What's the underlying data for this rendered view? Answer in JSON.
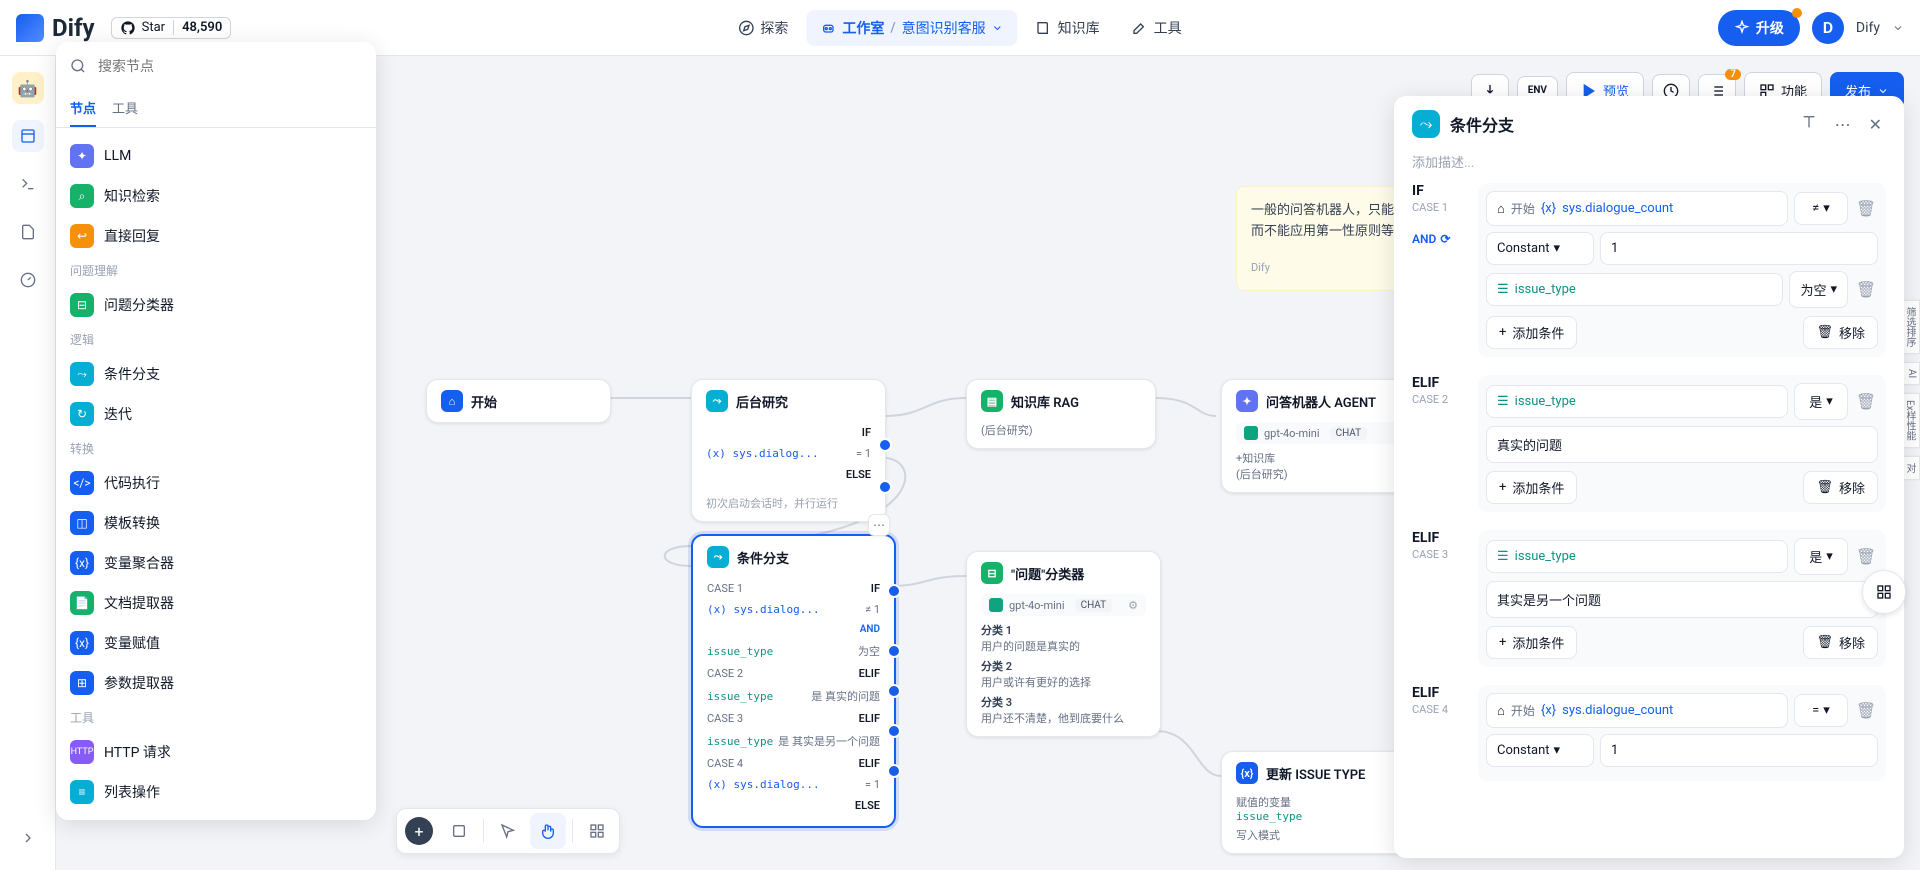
{
  "header": {
    "logo": "Dify",
    "star_label": "Star",
    "star_count": "48,590",
    "nav": {
      "explore": "探索",
      "studio": "工作室",
      "crumb": "意图识别客服",
      "knowledge": "知识库",
      "tools": "工具"
    },
    "upgrade": "升级",
    "avatar_letter": "D",
    "user": "Dify"
  },
  "node_panel": {
    "search_placeholder": "搜索节点",
    "tabs": {
      "nodes": "节点",
      "tools": "工具"
    },
    "items": [
      {
        "label": "LLM",
        "color": "#6172f3"
      },
      {
        "label": "知识检索",
        "color": "#17b26a"
      },
      {
        "label": "直接回复",
        "color": "#f79009"
      }
    ],
    "cat1": "问题理解",
    "items1": [
      {
        "label": "问题分类器",
        "color": "#17b26a"
      }
    ],
    "cat2": "逻辑",
    "items2": [
      {
        "label": "条件分支",
        "color": "#06aed4"
      },
      {
        "label": "迭代",
        "color": "#06aed4"
      }
    ],
    "cat3": "转换",
    "items3": [
      {
        "label": "代码执行",
        "color": "#155eef"
      },
      {
        "label": "模板转换",
        "color": "#155eef"
      },
      {
        "label": "变量聚合器",
        "color": "#155eef"
      },
      {
        "label": "文档提取器",
        "color": "#17b26a"
      },
      {
        "label": "变量赋值",
        "color": "#155eef"
      },
      {
        "label": "参数提取器",
        "color": "#155eef"
      }
    ],
    "cat4": "工具",
    "items4": [
      {
        "label": "HTTP 请求",
        "color": "#875bf7"
      },
      {
        "label": "列表操作",
        "color": "#06aed4"
      }
    ]
  },
  "toolbar": {
    "preview": "预览",
    "features": "功能",
    "publish": "发布",
    "badge": "7"
  },
  "note": {
    "line1": "一般的问答机器人，只能回答",
    "line2": "而不能应用第一性原则等高级",
    "author": "Dify"
  },
  "nodes": {
    "start": {
      "title": "开始"
    },
    "research": {
      "title": "后台研究",
      "if_label": "IF",
      "var": "(x) sys.dialog...",
      "eq": "= 1",
      "else_label": "ELSE",
      "caption": "初次启动会话时，并行运行"
    },
    "kb": {
      "title": "知识库 RAG",
      "sub": "(后台研究)"
    },
    "agent": {
      "title": "问答机器人 AGENT",
      "model": "gpt-4o-mini",
      "chat": "CHAT",
      "l1": "+知识库",
      "l2": "(后台研究)"
    },
    "branch": {
      "title": "条件分支",
      "case1": "CASE 1",
      "if": "IF",
      "c1_var": "(x) sys.dialog...",
      "c1_op": "≠ 1",
      "c1_var2": "issue_type",
      "c1_op2": "为空",
      "and": "AND",
      "case2": "CASE 2",
      "elif": "ELIF",
      "c2_var": "issue_type",
      "c2_op": "是 真实的问题",
      "case3": "CASE 3",
      "c3_var": "issue_type",
      "c3_op": "是 其实是另一个问题",
      "case4": "CASE 4",
      "c4_var": "(x) sys.dialog...",
      "c4_op": "= 1",
      "else": "ELSE"
    },
    "classifier": {
      "title": "\"问题\"分类器",
      "model": "gpt-4o-mini",
      "chat": "CHAT",
      "g1": "分类 1",
      "g1t": "用户的问题是真实的",
      "g2": "分类 2",
      "g2t": "用户或许有更好的选择",
      "g3": "分类 3",
      "g3t": "用户还不清楚，他到底要什么"
    },
    "update": {
      "title": "更新 ISSUE TYPE",
      "l1": "赋值的变量",
      "l2": "issue_type",
      "l3": "写入模式"
    }
  },
  "inspector": {
    "title": "条件分支",
    "desc_placeholder": "添加描述...",
    "if": "IF",
    "case1": "CASE 1",
    "start_src": "开始",
    "var_dialogue": "sys.dialogue_count",
    "op_ne": "≠",
    "and": "AND",
    "const": "Constant",
    "val1": "1",
    "var_issue": "issue_type",
    "op_empty": "为空",
    "add_cond": "添加条件",
    "remove": "移除",
    "elif": "ELIF",
    "case2": "CASE 2",
    "op_is": "是",
    "val_real": "真实的问题",
    "case3": "CASE 3",
    "val_other": "其实是另一个问题",
    "case4": "CASE 4",
    "op_eq": "="
  }
}
